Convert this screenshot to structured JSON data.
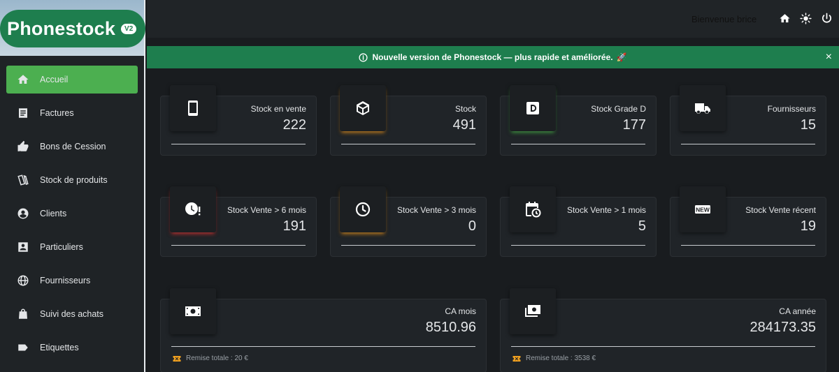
{
  "brand": {
    "name": "Phonestock",
    "badge": "V2"
  },
  "sidebar": {
    "items": [
      {
        "label": "Accueil",
        "icon": "home-icon",
        "active": true
      },
      {
        "label": "Factures",
        "icon": "document-icon"
      },
      {
        "label": "Bons de Cession",
        "icon": "thumbs-up-icon"
      },
      {
        "label": "Stock de produits",
        "icon": "cards-icon"
      },
      {
        "label": "Clients",
        "icon": "account-circle-icon"
      },
      {
        "label": "Particuliers",
        "icon": "account-box-icon"
      },
      {
        "label": "Fournisseurs",
        "icon": "globe-icon"
      },
      {
        "label": "Suivi des achats",
        "icon": "shopping-bag-icon"
      },
      {
        "label": "Etiquettes",
        "icon": "label-icon"
      }
    ]
  },
  "topbar": {
    "welcome": "Bienvenue brice",
    "icons": [
      "home-icon",
      "sun-icon",
      "power-icon"
    ]
  },
  "banner": {
    "text": "Nouvelle version de Phonestock — plus rapide et améliorée.",
    "emoji": "🚀",
    "close": "×"
  },
  "stats": [
    {
      "label": "Stock en vente",
      "value": "222",
      "icon": "phone-icon"
    },
    {
      "label": "Stock",
      "value": "491",
      "icon": "cube-icon",
      "accent": "#e8962a"
    },
    {
      "label": "Stock Grade D",
      "value": "177",
      "icon": "grade-d-icon",
      "accent": "#4caf50"
    },
    {
      "label": "Fournisseurs",
      "value": "15",
      "icon": "truck-icon"
    },
    {
      "label": "Stock Vente > 6 mois",
      "value": "191",
      "icon": "clock-alert-icon",
      "accent": "#dc3c3c"
    },
    {
      "label": "Stock Vente > 3 mois",
      "value": "0",
      "icon": "clock-icon",
      "accent": "#e8962a"
    },
    {
      "label": "Stock Vente > 1 mois",
      "value": "5",
      "icon": "calendar-clock-icon"
    },
    {
      "label": "Stock Vente récent",
      "value": "19",
      "icon": "new-badge-icon"
    }
  ],
  "revenue": [
    {
      "label": "CA mois",
      "value": "8510.96",
      "footer": "Remise totale : 20 €",
      "icon": "cash-icon"
    },
    {
      "label": "CA année",
      "value": "284173.35",
      "footer": "Remise totale : 3538 €",
      "icon": "cash-multiple-icon"
    }
  ],
  "colors": {
    "brand_green": "#1e7e4e",
    "active_green": "#4caf50",
    "background": "#191c1f",
    "card": "#202428"
  }
}
